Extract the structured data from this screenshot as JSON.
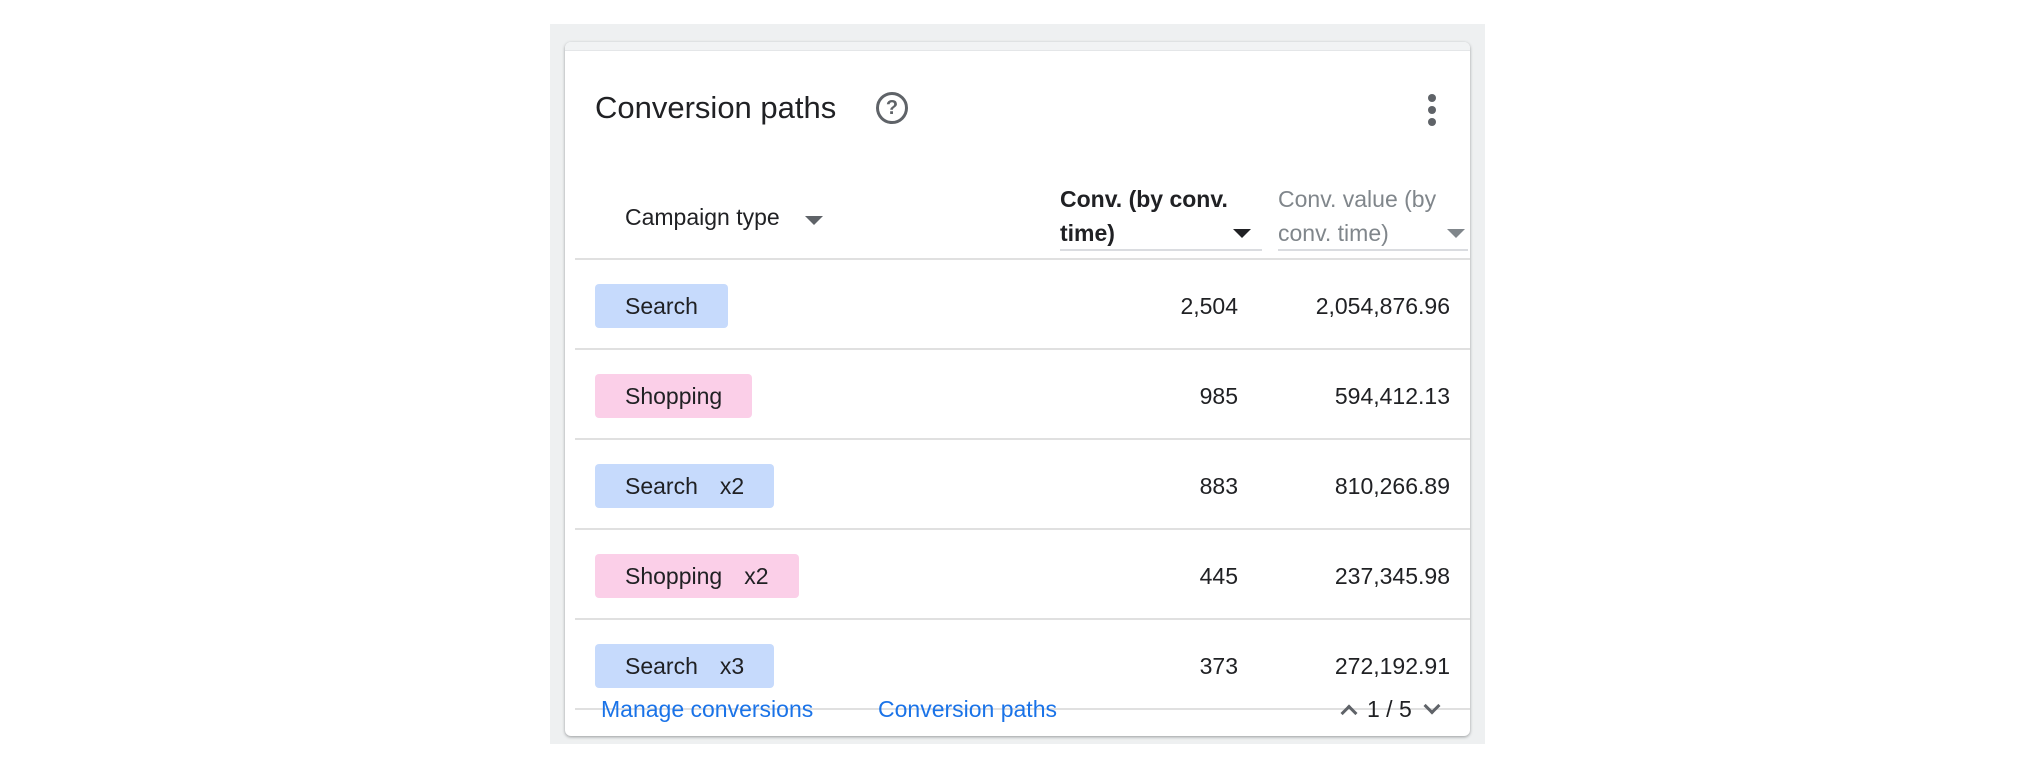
{
  "card": {
    "title": "Conversion paths",
    "help_icon": "help-circle-icon",
    "more_icon": "more-vert-icon"
  },
  "columns": {
    "campaign_type": "Campaign type",
    "conv_line1": "Conv. (by conv.",
    "conv_line2": "time)",
    "value_line1": "Conv. value (by",
    "value_line2": "conv. time)"
  },
  "rows": [
    {
      "path": "Search",
      "multiplier": "",
      "color": "#c6dafc",
      "conv": "2,504",
      "value": "2,054,876.96"
    },
    {
      "path": "Shopping",
      "multiplier": "",
      "color": "#fbcfe8",
      "conv": "985",
      "value": "594,412.13"
    },
    {
      "path": "Search",
      "multiplier": "x2",
      "color": "#c6dafc",
      "conv": "883",
      "value": "810,266.89"
    },
    {
      "path": "Shopping",
      "multiplier": "x2",
      "color": "#fbcfe8",
      "conv": "445",
      "value": "237,345.98"
    },
    {
      "path": "Search",
      "multiplier": "x3",
      "color": "#c6dafc",
      "conv": "373",
      "value": "272,192.91"
    }
  ],
  "footer": {
    "manage_conversions": "Manage conversions",
    "conversion_paths": "Conversion paths",
    "pager": "1 / 5"
  },
  "colors": {
    "link": "#1a73e8",
    "search_chip": "#c6dafc",
    "shopping_chip": "#fbcfe8"
  }
}
